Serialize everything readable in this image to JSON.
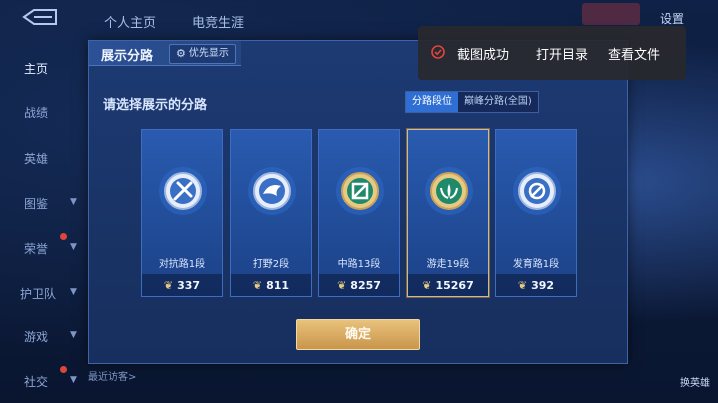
{
  "sidebar": {
    "items": [
      {
        "label": "主页",
        "active": true
      },
      {
        "label": "战绩"
      },
      {
        "label": "英雄"
      },
      {
        "label": "图鉴"
      },
      {
        "label": "荣誉"
      },
      {
        "label": "护卫队"
      },
      {
        "label": "游戏"
      },
      {
        "label": "社交"
      }
    ]
  },
  "top_tabs": [
    "个人主页",
    "电竞生涯"
  ],
  "top_right": {
    "settings_label": "设置"
  },
  "panel": {
    "title": "展示分路",
    "priority_label": "优先显示",
    "prompt": "请选择展示的分路",
    "toggle": [
      "分路段位",
      "巅峰分路(全国)"
    ],
    "cards": [
      {
        "name": "对抗路1段",
        "score": "337",
        "emblem": "sword-emblem-icon"
      },
      {
        "name": "打野2段",
        "score": "811",
        "emblem": "beast-emblem-icon"
      },
      {
        "name": "中路13段",
        "score": "8257",
        "emblem": "mid-emblem-icon"
      },
      {
        "name": "游走19段",
        "score": "15267",
        "emblem": "support-emblem-icon"
      },
      {
        "name": "发育路1段",
        "score": "392",
        "emblem": "archer-emblem-icon"
      }
    ],
    "selected_index": 3,
    "confirm_label": "确定"
  },
  "toast": {
    "message": "截图成功",
    "open_dir": "打开目录",
    "view_file": "查看文件"
  },
  "bottom": {
    "visitors_label": "最近访客>"
  },
  "right_side": {
    "switch_hero_label": "换英雄"
  },
  "colors": {
    "accent_gold": "#d9b878",
    "toggle_active": "#2f6fd4",
    "toast_check": "#e0453a"
  }
}
